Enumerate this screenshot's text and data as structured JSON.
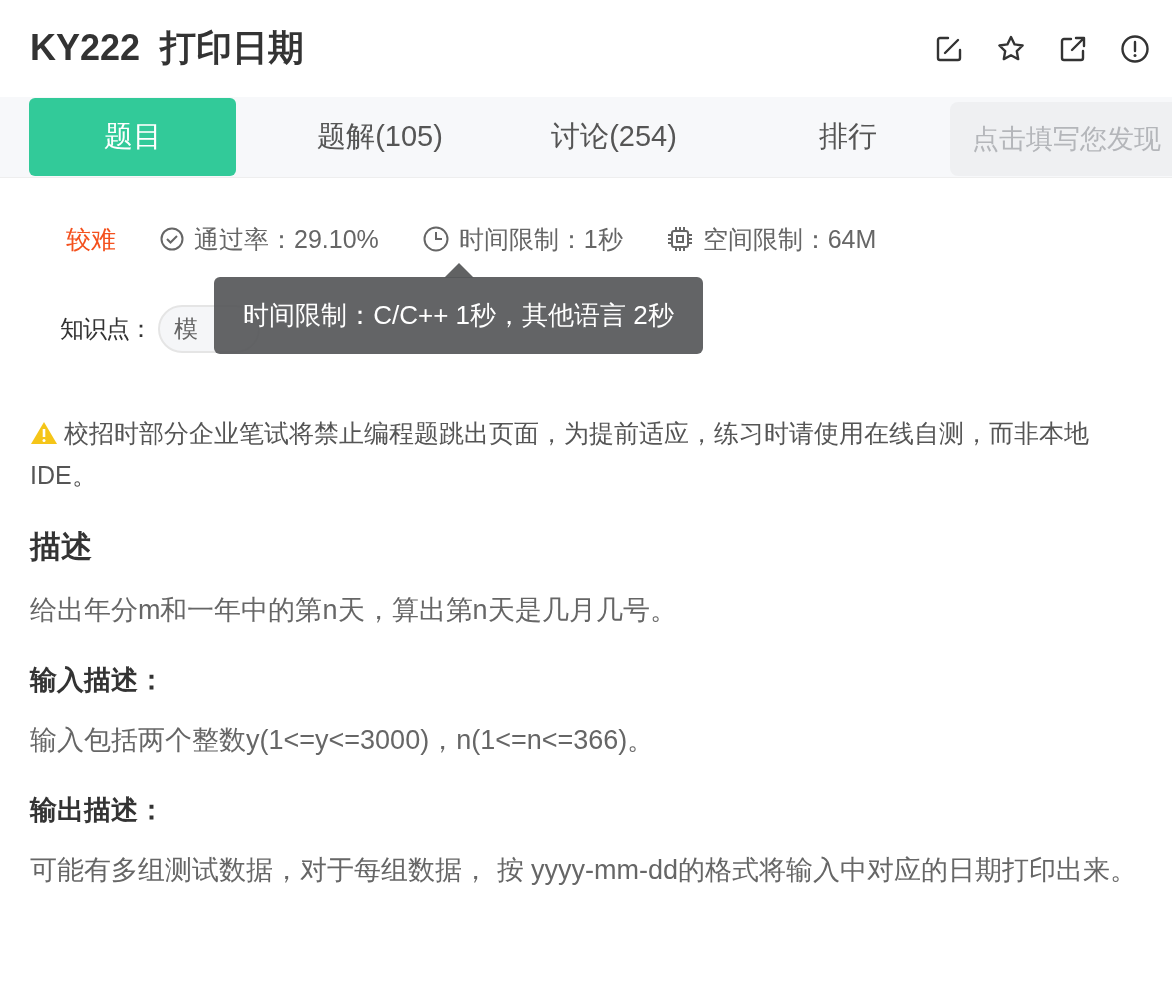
{
  "title": "KY222  打印日期",
  "tabs": [
    {
      "label": "题目",
      "selected": true
    },
    {
      "label": "题解(105)",
      "selected": false
    },
    {
      "label": "讨论(254)",
      "selected": false
    },
    {
      "label": "排行",
      "selected": false
    }
  ],
  "feedback_tooltip": "点击填写您发现",
  "meta": {
    "difficulty": "较难",
    "pass_rate": "通过率：29.10%",
    "time_limit": "时间限制：1秒",
    "memory_limit": "空间限制：64M"
  },
  "knowledge": {
    "label": "知识点：",
    "tags": [
      "模"
    ]
  },
  "time_tooltip": "时间限制：C/C++ 1秒，其他语言 2秒",
  "notice": "校招时部分企业笔试将禁止编程题跳出页面，为提前适应，练习时请使用在线自测，而非本地IDE。",
  "sections": [
    {
      "heading": "描述",
      "body": "给出年分m和一年中的第n天，算出第n天是几月几号。"
    },
    {
      "heading": "输入描述：",
      "body": "输入包括两个整数y(1<=y<=3000)，n(1<=n<=366)。"
    },
    {
      "heading": "输出描述：",
      "body": "可能有多组测试数据，对于每组数据， 按 yyyy-mm-dd的格式将输入中对应的日期打印出来。"
    }
  ]
}
